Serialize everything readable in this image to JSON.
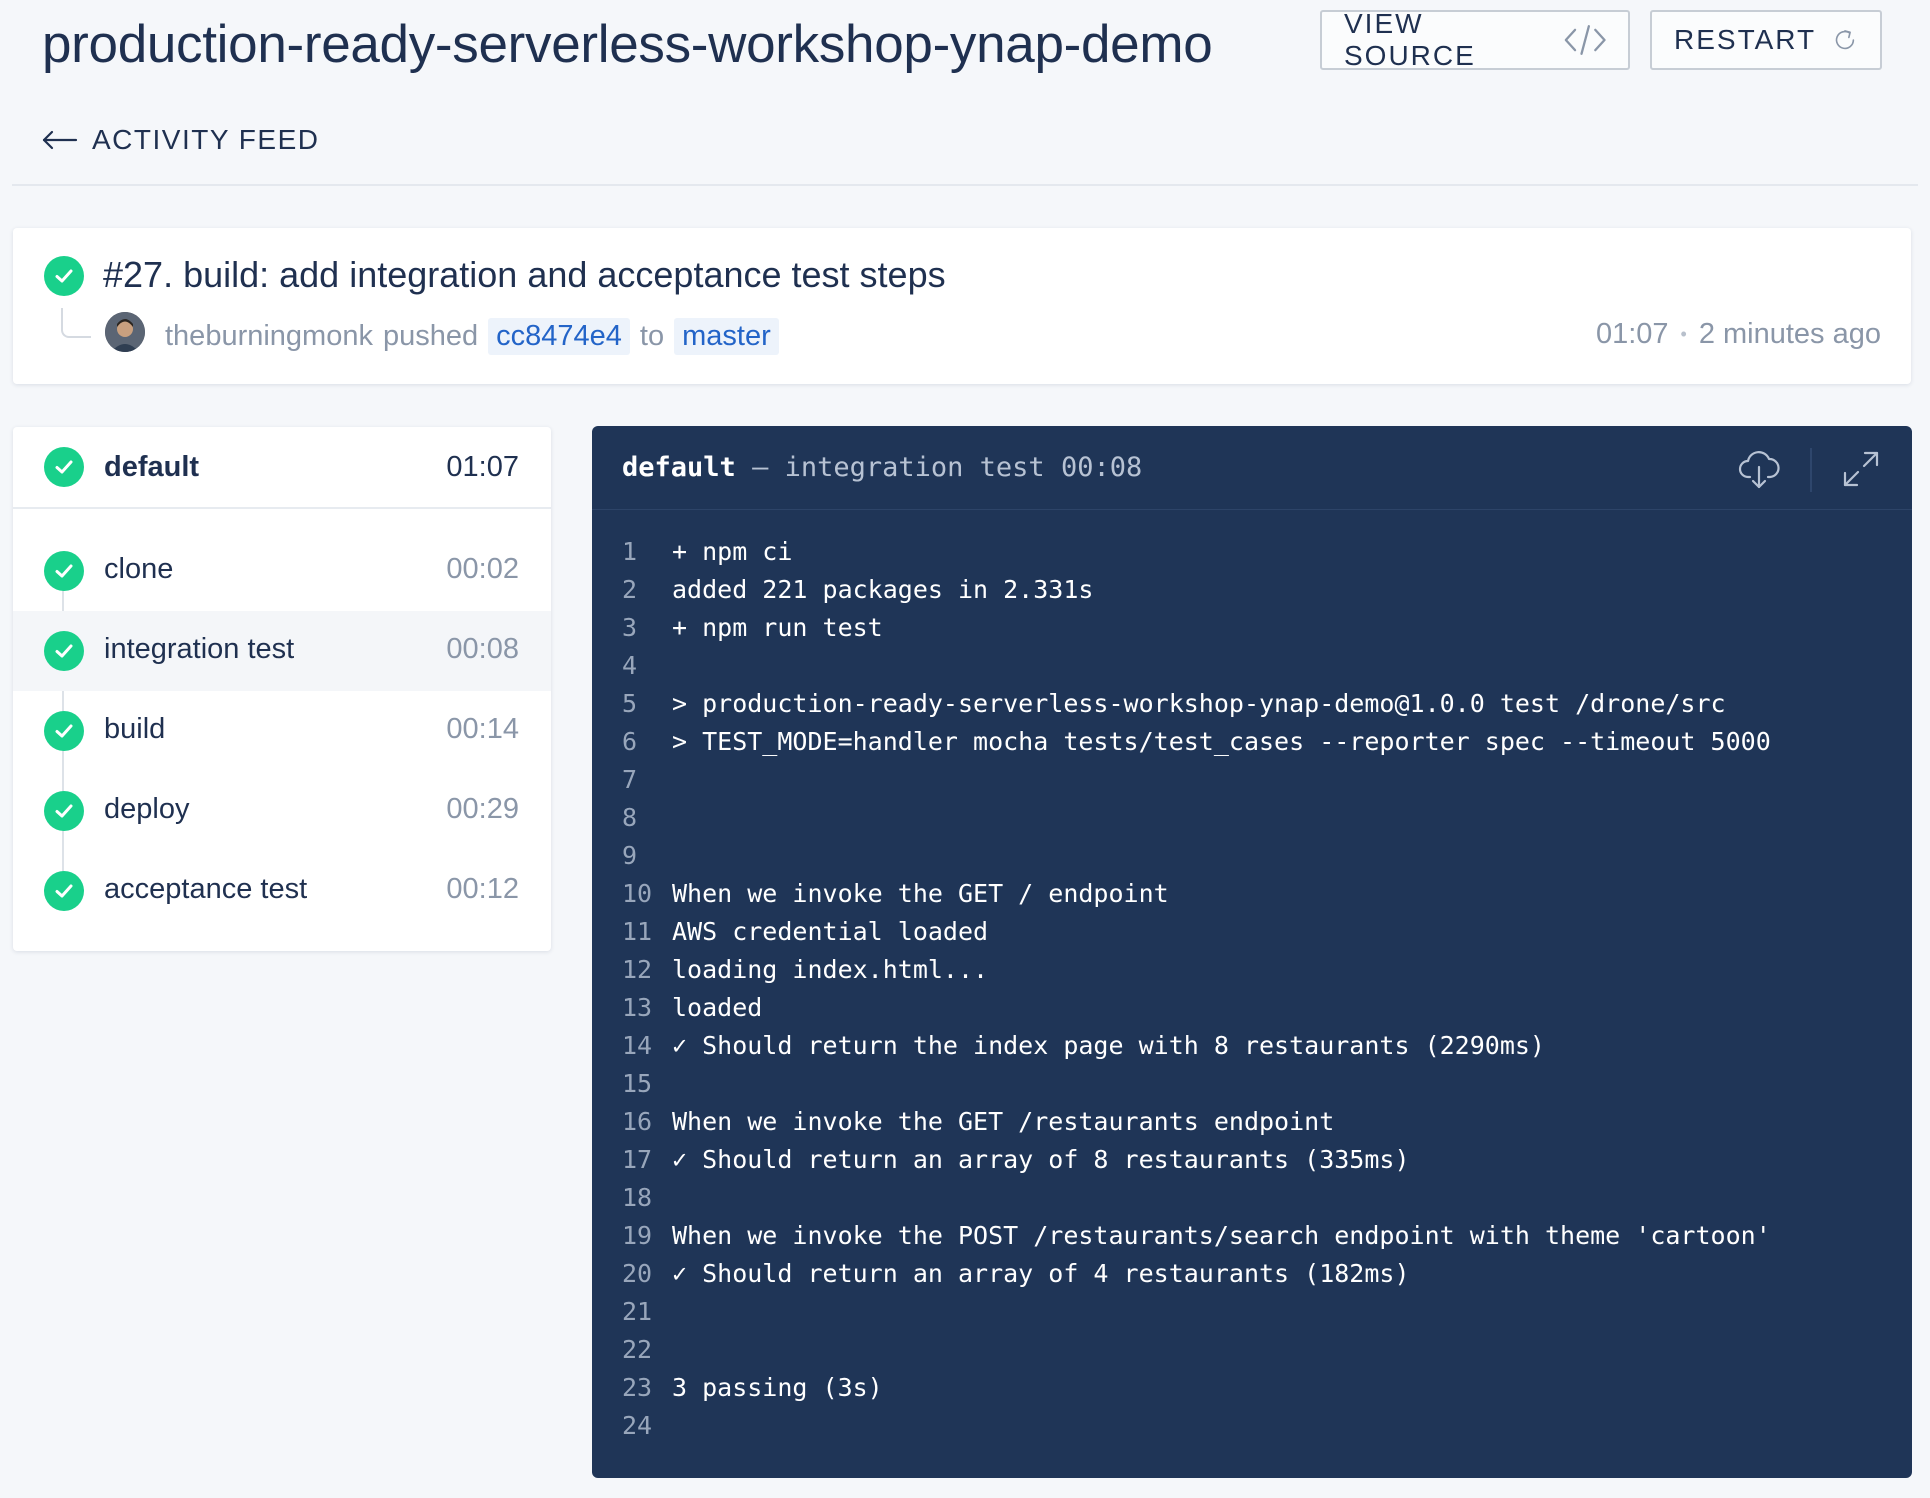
{
  "header": {
    "repo_title": "production-ready-serverless-workshop-ynap-demo",
    "view_source_label": "VIEW SOURCE",
    "restart_label": "RESTART",
    "back_label": "ACTIVITY FEED"
  },
  "build": {
    "title": "#27. build: add integration and acceptance test steps",
    "author": "theburningmonk",
    "action": "pushed",
    "commit": "cc8474e4",
    "to": "to",
    "branch": "master",
    "duration": "01:07",
    "ago": "2 minutes ago"
  },
  "stage": {
    "name": "default",
    "duration": "01:07"
  },
  "steps": [
    {
      "name": "clone",
      "duration": "00:02"
    },
    {
      "name": "integration test",
      "duration": "00:08"
    },
    {
      "name": "build",
      "duration": "00:14"
    },
    {
      "name": "deploy",
      "duration": "00:29"
    },
    {
      "name": "acceptance test",
      "duration": "00:12"
    }
  ],
  "log": {
    "stage": "default",
    "separator": "—",
    "step": "integration test",
    "duration": "00:08",
    "lines": [
      {
        "n": "1",
        "text": "+ npm ci"
      },
      {
        "n": "2",
        "text": "added 221 packages in 2.331s"
      },
      {
        "n": "3",
        "text": "+ npm run test"
      },
      {
        "n": "4",
        "text": ""
      },
      {
        "n": "5",
        "text": "> production-ready-serverless-workshop-ynap-demo@1.0.0 test /drone/src"
      },
      {
        "n": "6",
        "text": "> TEST_MODE=handler mocha tests/test_cases --reporter spec --timeout 5000"
      },
      {
        "n": "7",
        "text": ""
      },
      {
        "n": "8",
        "text": ""
      },
      {
        "n": "9",
        "text": ""
      },
      {
        "n": "10",
        "text": "When we invoke the GET / endpoint"
      },
      {
        "n": "11",
        "text": "AWS credential loaded"
      },
      {
        "n": "12",
        "text": "loading index.html..."
      },
      {
        "n": "13",
        "text": "loaded"
      },
      {
        "n": "14",
        "text": "✓ Should return the index page with 8 restaurants (2290ms)"
      },
      {
        "n": "15",
        "text": ""
      },
      {
        "n": "16",
        "text": "When we invoke the GET /restaurants endpoint"
      },
      {
        "n": "17",
        "text": "✓ Should return an array of 8 restaurants (335ms)"
      },
      {
        "n": "18",
        "text": ""
      },
      {
        "n": "19",
        "text": "When we invoke the POST /restaurants/search endpoint with theme 'cartoon'"
      },
      {
        "n": "20",
        "text": "✓ Should return an array of 4 restaurants (182ms)"
      },
      {
        "n": "21",
        "text": ""
      },
      {
        "n": "22",
        "text": ""
      },
      {
        "n": "23",
        "text": "3 passing (3s)"
      },
      {
        "n": "24",
        "text": ""
      }
    ]
  },
  "icons": {
    "view_source": "code-icon",
    "restart": "refresh-icon",
    "back": "arrow-left-icon",
    "status": "check-circle-icon",
    "download": "cloud-download-icon",
    "expand": "expand-icon"
  },
  "colors": {
    "success": "#19d08b",
    "log_background": "#1f3557",
    "link": "#2364c8",
    "text": "#1f3050"
  }
}
